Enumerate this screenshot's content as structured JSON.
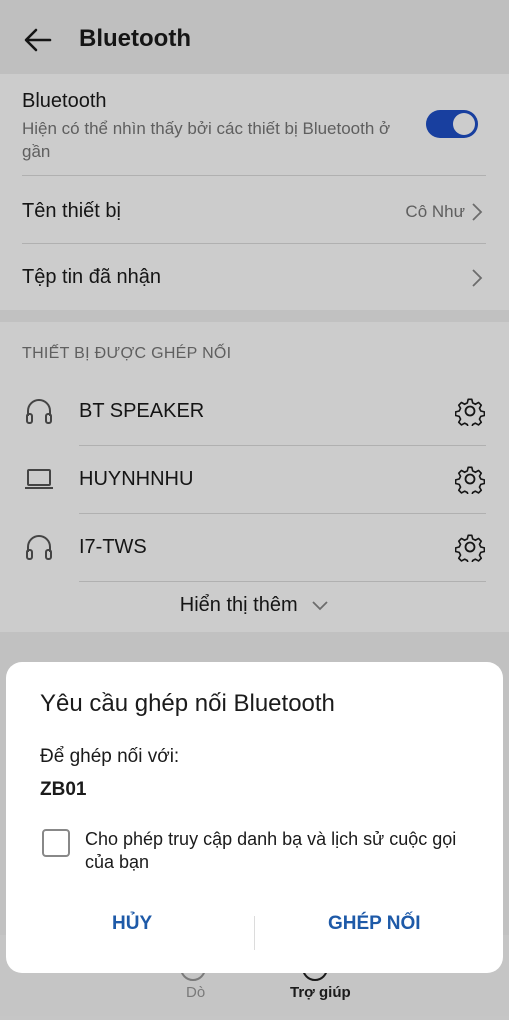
{
  "appbar": {
    "title": "Bluetooth"
  },
  "bluetooth": {
    "label": "Bluetooth",
    "subtitle": "Hiện có thể nhìn thấy bởi các thiết bị Bluetooth ở gần",
    "enabled": true
  },
  "device_name": {
    "label": "Tên thiết bị",
    "value": "Cô Như"
  },
  "received_files": {
    "label": "Tệp tin đã nhận"
  },
  "paired": {
    "header": "THIẾT BỊ ĐƯỢC GHÉP NỐI",
    "devices": [
      {
        "name": "BT SPEAKER",
        "icon": "headphones-icon"
      },
      {
        "name": "HUYNHNHU",
        "icon": "laptop-icon"
      },
      {
        "name": "I7-TWS",
        "icon": "headphones-icon"
      }
    ],
    "show_more": "Hiển thị thêm"
  },
  "bottom_nav": {
    "left": "Dò",
    "right": "Trợ giúp"
  },
  "dialog": {
    "title": "Yêu cầu ghép nối Bluetooth",
    "pair_with_label": "Để ghép nối với:",
    "device": "ZB01",
    "checkbox_label": "Cho phép truy cập danh bạ và lịch sử cuộc gọi của bạn",
    "checkbox_checked": false,
    "cancel": "HỦY",
    "pair": "GHÉP NỐI"
  },
  "colors": {
    "accent": "#1e4fc7",
    "button_text": "#1e5aa8"
  }
}
